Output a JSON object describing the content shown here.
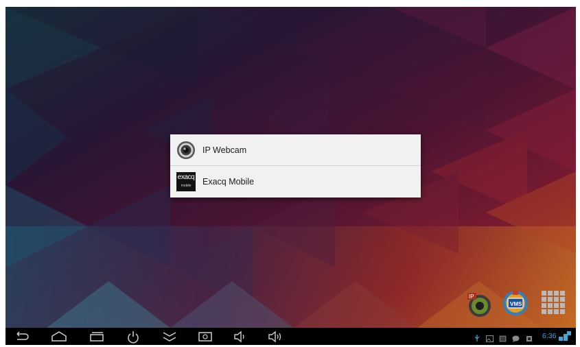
{
  "chooser": {
    "items": [
      {
        "label": "IP Webcam",
        "icon": "ip-webcam-icon"
      },
      {
        "label": "Exacq Mobile",
        "icon": "exacq-mobile-icon",
        "icon_text_line1": "exacq",
        "icon_text_line2": "mobile"
      }
    ]
  },
  "dock": {
    "ip_webcam_badge": "IP",
    "vms_label": "VMS"
  },
  "navigation": [
    "back-icon",
    "home-icon",
    "recent-apps-icon",
    "power-icon",
    "collapse-icon",
    "screenshot-icon",
    "volume-down-icon",
    "volume-up-icon"
  ],
  "status_bar": {
    "time": "6:36",
    "icons": [
      "usb-icon",
      "image-notification-icon",
      "gallery-notification-icon",
      "chat-notification-icon",
      "storage-icon",
      "wifi-icon"
    ]
  },
  "colors": {
    "clock": "#3fa8dc",
    "dialog_background": "#f1f1f1"
  }
}
